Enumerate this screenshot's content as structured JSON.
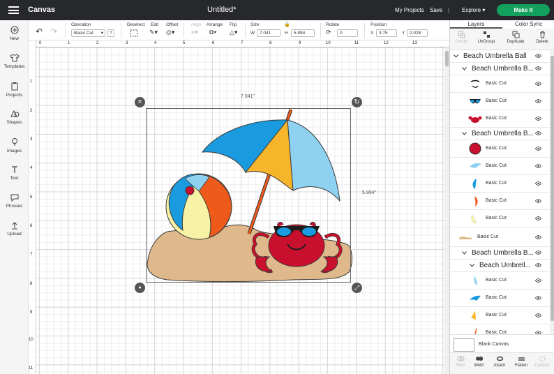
{
  "topbar": {
    "app_name": "Canvas",
    "doc_title": "Untitled*",
    "my_projects": "My Projects",
    "save": "Save",
    "separator": "|",
    "explore": "Explore",
    "make_it": "Make It",
    "make_it_color": "#12a05c"
  },
  "leftbar": [
    "New",
    "Templates",
    "Projects",
    "Shapes",
    "Images",
    "Text",
    "Phrases",
    "Upload"
  ],
  "toolbar": {
    "operation_label": "Operation",
    "operation_value": "Basic Cut",
    "help": "?",
    "deselect": "Deselect",
    "edit": "Edit",
    "offset": "Offset",
    "align": "Align",
    "arrange": "Arrange",
    "flip": "Flip",
    "size_label": "Size",
    "w_label": "W",
    "w_value": "7.041",
    "h_label": "H",
    "h_value": "5.994",
    "rotate_label": "Rotate",
    "rotate_value": "0",
    "position_label": "Position",
    "x_label": "X",
    "x_value": "3.75",
    "y_label": "Y",
    "y_value": "2.028"
  },
  "ruler": {
    "top": [
      "0",
      "1",
      "2",
      "3",
      "4",
      "5",
      "6",
      "7",
      "8",
      "9",
      "10",
      "11",
      "12",
      "13"
    ],
    "left": [
      "1",
      "2",
      "3",
      "4",
      "5",
      "6",
      "7",
      "8",
      "9",
      "10",
      "11"
    ]
  },
  "canvas": {
    "width_label": "7.041\"",
    "height_label": "5.994\""
  },
  "panel": {
    "tab_layers": "Layers",
    "tab_color_sync": "Color Sync",
    "tools": [
      "Group",
      "UnGroup",
      "Duplicate",
      "Delete"
    ],
    "layers": [
      {
        "name": "Beach Umbrella Ball",
        "kind": "group0"
      },
      {
        "name": "Beach Umbrella B...",
        "kind": "group1"
      },
      {
        "name": "Basic Cut",
        "kind": "leaf",
        "icon": "mouth-shape"
      },
      {
        "name": "Basic Cut",
        "kind": "leaf",
        "icon": "sunglasses-shape"
      },
      {
        "name": "Basic Cut",
        "kind": "leaf",
        "icon": "crab-shape"
      },
      {
        "name": "Beach Umbrella B...",
        "kind": "group1"
      },
      {
        "name": "Basic Cut",
        "kind": "leaf",
        "icon": "red-ball-shape"
      },
      {
        "name": "Basic Cut",
        "kind": "leaf",
        "icon": "light-blue-wedge-shape"
      },
      {
        "name": "Basic Cut",
        "kind": "leaf",
        "icon": "blue-wedge-shape"
      },
      {
        "name": "Basic Cut",
        "kind": "leaf",
        "icon": "orange-wedge-shape"
      },
      {
        "name": "Basic Cut",
        "kind": "leaf",
        "icon": "yellow-wedge-shape"
      },
      {
        "name": "Basic Cut",
        "kind": "leaf-top",
        "icon": "sand-shape"
      },
      {
        "name": "Beach Umbrella B...",
        "kind": "group1"
      },
      {
        "name": "Beach Umbrell...",
        "kind": "group2"
      },
      {
        "name": "Basic Cut",
        "kind": "leaf",
        "icon": "light-blue-umbrella-panel"
      },
      {
        "name": "Basic Cut",
        "kind": "leaf",
        "icon": "blue-umbrella-panel"
      },
      {
        "name": "Basic Cut",
        "kind": "leaf",
        "icon": "yellow-umbrella-panel"
      },
      {
        "name": "Basic Cut",
        "kind": "leaf",
        "icon": "umbrella-pole"
      }
    ],
    "blank_canvas": "Blank Canvas",
    "bottom": [
      "Slice",
      "Weld",
      "Attach",
      "Flatten",
      "Contour"
    ]
  },
  "colors": {
    "topbar": "#26282b",
    "umbrella_blue": "#1a9be0",
    "umbrella_yellow": "#f7b52c",
    "umbrella_light": "#8ed1f0",
    "ball_orange": "#ee5a1a",
    "ball_yellow": "#f8f2a6",
    "crab_red": "#c8102e",
    "sand": "#dfb98c"
  }
}
